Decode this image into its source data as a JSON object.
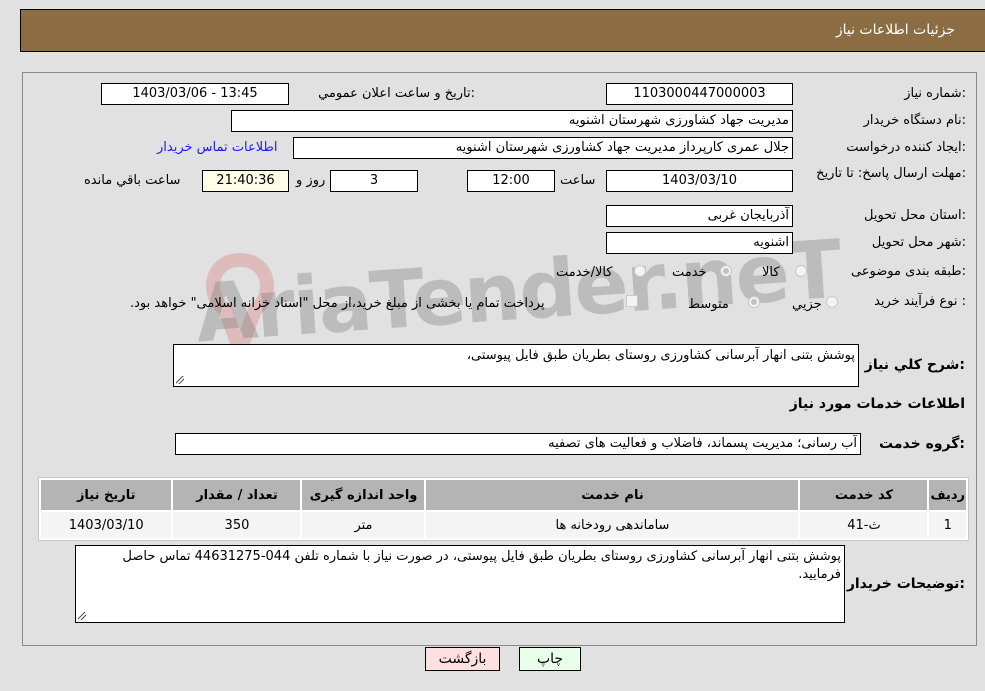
{
  "header": {
    "title": "جزئيات اطلاعات نياز"
  },
  "form": {
    "need_number": {
      "label": "شماره نياز:",
      "value": "1103000447000003"
    },
    "announce_datetime": {
      "label": "تاريخ و ساعت اعلان عمومي:",
      "value": "1403/03/06 - 13:45"
    },
    "buyer_org": {
      "label": "نام دستگاه خريدار:",
      "value": "مديريت جهاد كشاورزی شهرستان اشنويه"
    },
    "requester": {
      "label": "ايجاد كننده درخواست:",
      "value": "جلال عمری كارپرداز مديريت جهاد كشاورزی شهرستان اشنويه"
    },
    "buyer_contact_link": "اطلاعات تماس خريدار",
    "deadline": {
      "label": "مهلت ارسال پاسخ: تا تاريخ:",
      "date": "1403/03/10",
      "time_label": "ساعت",
      "time": "12:00",
      "days": "3",
      "days_label": "روز و",
      "remaining": "21:40:36",
      "remaining_label": "ساعت باقي مانده"
    },
    "province": {
      "label": "استان محل تحويل:",
      "value": "آذربايجان غربی"
    },
    "city": {
      "label": "شهر محل تحويل:",
      "value": "اشنويه"
    },
    "category": {
      "label": "طبقه بندی موضوعی:",
      "options": [
        {
          "label": "كالا",
          "checked": false
        },
        {
          "label": "خدمت",
          "checked": true
        },
        {
          "label": "كالا/خدمت",
          "checked": false
        }
      ]
    },
    "purchase_type": {
      "label": "نوع فرآيند خريد :",
      "options": [
        {
          "label": "جزيي",
          "checked": false
        },
        {
          "label": "متوسط",
          "checked": true
        }
      ],
      "treasury_note": "پرداخت تمام يا بخشی از مبلغ خريد،از محل \"اسناد خزانه اسلامی\" خواهد بود."
    },
    "general_description": {
      "label": "شرح كلي نياز:",
      "value": "پوشش بتنی انهار آبرسانی كشاورزی روستای بطريان طبق فايل پيوستی،"
    },
    "services_section_title": "اطلاعات خدمات مورد نياز",
    "service_group": {
      "label": "گروه خدمت:",
      "value": "آب رسانی؛ مديريت پسماند، فاضلاب و فعاليت های تصفيه"
    }
  },
  "table": {
    "columns": [
      "رديف",
      "كد خدمت",
      "نام خدمت",
      "واحد اندازه گيری",
      "تعداد / مقدار",
      "تاريخ نياز"
    ],
    "rows": [
      [
        "1",
        "ث-41",
        "ساماندهی رودخانه ها",
        "متر",
        "350",
        "1403/03/10"
      ]
    ]
  },
  "buyer_notes": {
    "label": "توضيحات خريدار:",
    "value": "پوشش بتنی انهار آبرسانی كشاورزی روستای بطريان طبق فايل پيوستی، در صورت نياز با شماره تلفن 044-44631275 تماس حاصل فرماييد."
  },
  "buttons": {
    "print": "چاپ",
    "back": "بازگشت"
  },
  "colors": {
    "header_bg": "#8c6d43",
    "print_bg": "#eaffea",
    "back_bg": "#ffe0e0",
    "link": "#1a1aff"
  },
  "watermark": "AriaTender.neT"
}
